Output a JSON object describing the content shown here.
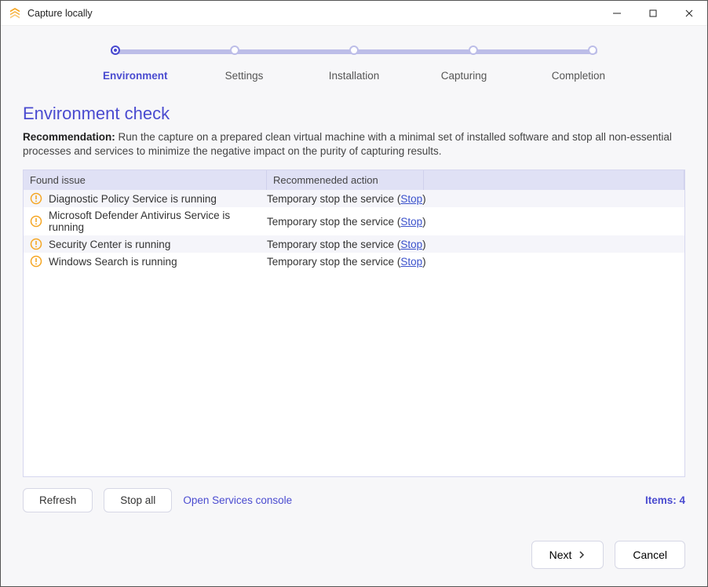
{
  "window": {
    "title": "Capture locally"
  },
  "wizard": {
    "steps": [
      "Environment",
      "Settings",
      "Installation",
      "Capturing",
      "Completion"
    ],
    "active_index": 0
  },
  "page": {
    "title": "Environment check",
    "recommendation_label": "Recommendation: ",
    "recommendation_text": "Run the capture on a prepared clean virtual machine with a minimal set of installed software and stop all non-essential processes and services to minimize the negative impact on the purity of capturing results."
  },
  "table": {
    "columns": [
      "Found issue",
      "Recommeneded action"
    ],
    "action_prefix": "Temporary stop the service (",
    "action_link": "Stop",
    "action_suffix": ")",
    "rows": [
      {
        "issue": "Diagnostic Policy Service is running"
      },
      {
        "issue": "Microsoft Defender Antivirus Service is running"
      },
      {
        "issue": "Security Center is running"
      },
      {
        "issue": "Windows Search is running"
      }
    ]
  },
  "toolbar": {
    "refresh": "Refresh",
    "stop_all": "Stop all",
    "open_services": "Open Services console",
    "items_label": "Items: ",
    "items_count": 4
  },
  "footer": {
    "next": "Next",
    "cancel": "Cancel"
  }
}
